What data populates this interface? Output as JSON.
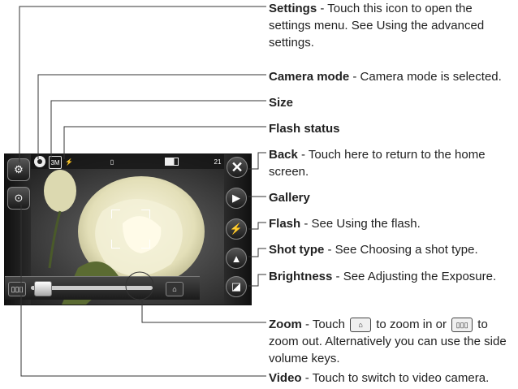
{
  "screen": {
    "indicators": {
      "size_label": "3M",
      "flash_label": "AUTO",
      "storage_label": "",
      "shot_count": "21"
    }
  },
  "annotations": {
    "settings": {
      "title": "Settings",
      "text": " - Touch this icon to open the settings menu. See Using the advanced settings."
    },
    "camera_mode": {
      "title": "Camera mode",
      "text": " - Camera mode is selected."
    },
    "size": {
      "title": "Size",
      "text": ""
    },
    "flash_status": {
      "title": "Flash status",
      "text": ""
    },
    "back": {
      "title": "Back",
      "text": " - Touch here to return to the home screen."
    },
    "gallery": {
      "title": "Gallery",
      "text": ""
    },
    "flash": {
      "title": "Flash",
      "text": " - See Using the flash."
    },
    "shot_type": {
      "title": "Shot type",
      "text": " - See Choosing a shot type."
    },
    "brightness": {
      "title": "Brightness",
      "text": " - See Adjusting the Exposure."
    },
    "zoom": {
      "title": "Zoom",
      "text_a": " - Touch ",
      "text_b": " to zoom in or ",
      "text_c": " to zoom out. Alternatively you can use the side volume keys."
    },
    "video": {
      "title": "Video",
      "text": " - Touch to switch to video camera."
    }
  },
  "icons": {
    "settings": "gear-icon",
    "video": "video-camera-icon",
    "back": "close-icon",
    "gallery": "play-icon",
    "flash": "flash-icon",
    "shot_type": "picture-icon",
    "brightness": "exposure-icon",
    "zoom_in": "zoom-in-icon",
    "zoom_out": "zoom-out-icon"
  },
  "colors": {
    "leader_line": "#333333",
    "flower": "#e9e6c8",
    "screen_bg": "#222222"
  }
}
